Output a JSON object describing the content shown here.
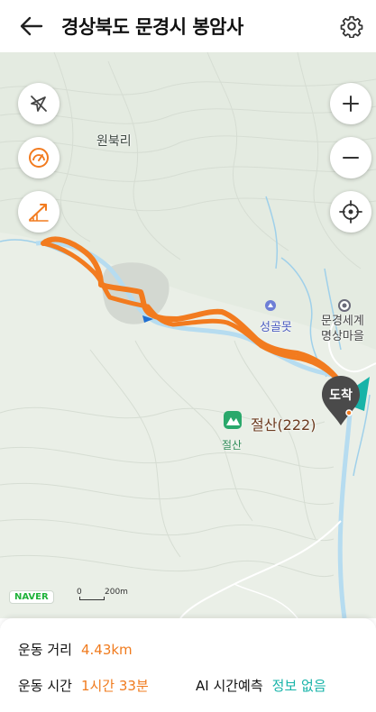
{
  "header": {
    "title": "경상북도 문경시 봉암사"
  },
  "map": {
    "place_labels": {
      "village": "원북리",
      "pond": "성골못",
      "meditation_line1": "문경세계",
      "meditation_line2": "명상마을",
      "mountain": "절산(222)",
      "mountain_sub": "절산"
    },
    "arrival_label": "도착",
    "naver_logo": "NAVER",
    "scale": {
      "zero": "0",
      "distance": "200m"
    },
    "route_color": "#f27b1f"
  },
  "info": {
    "distance_label": "운동 거리",
    "distance_value": "4.43km",
    "time_label": "운동 시간",
    "time_value": "1시간 33분",
    "ai_label": "AI 시간예측",
    "ai_value": "정보 없음"
  }
}
